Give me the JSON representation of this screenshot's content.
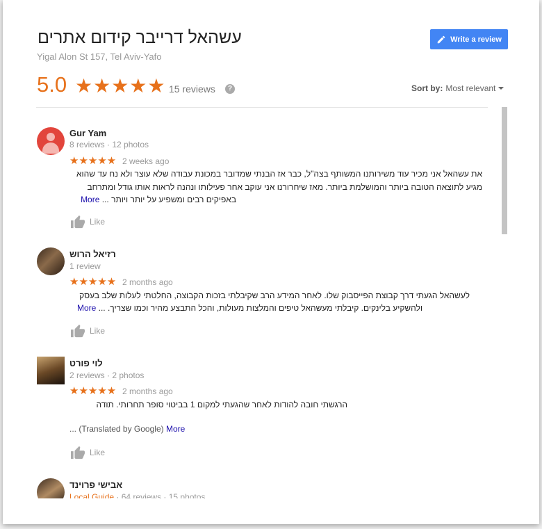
{
  "header": {
    "title": "עשהאל דרייבר קידום אתרים",
    "address": "Yigal Alon St 157, Tel Aviv-Yafo",
    "write_review_label": "Write a review",
    "rating": "5.0",
    "stars": "★★★★★",
    "review_count": "15 reviews",
    "help": "?",
    "sort_label": "Sort by:",
    "sort_value": "Most relevant"
  },
  "colors": {
    "star": "#e7711b",
    "button": "#4285f4",
    "link": "#1a0dab"
  },
  "reviews": [
    {
      "name": "Gur Yam",
      "meta": "8 reviews · 12 photos",
      "stars": "★★★★★",
      "date": "2 weeks ago",
      "text_1": "את עשהאל אני מכיר עוד משירותנו המשותף בצה\"ל, כבר אז הבנתי שמדובר במכונת עבודה שלא עוצר ולא נח עד שהוא",
      "text_2": "מגיע לתוצאה הטובה ביותר והמושלמת ביותר. מאז שיחרורנו אני עוקב אחר פעילותו ונהנה לראות אותו גודל ומתרחב",
      "text_3": "באפיקים רבים ומשפיע על יותר ויותר ...",
      "more": "More",
      "like": "Like"
    },
    {
      "name": "רזיאל הרוש",
      "meta": "1 review",
      "stars": "★★★★★",
      "date": "2 months ago",
      "text_1": "לעשהאל הגעתי דרך קבוצת הפייסבוק שלו. לאחר המידע הרב שקיבלתי בזכות הקבוצה, החלטתי לעלות שלב בעסק",
      "text_2": "ולהשקיע בלינקים. קיבלתי מעשהאל טיפים והמלצות מעולות, והכל התבצע מהיר וכמו שצריך. ...",
      "more": "More",
      "like": "Like"
    },
    {
      "name": "לוי פורט",
      "meta": "2 reviews · 2 photos",
      "stars": "★★★★★",
      "date": "2 months ago",
      "text_1": "הרגשתי חובה להודות לאחר שהגעתי למקום 1 בביטוי סופר תחרותי. תודה",
      "text_2": "... (Translated by Google)",
      "more": "More",
      "like": "Like"
    },
    {
      "name": "אבישי פרוינד",
      "meta_guide": "Local Guide",
      "meta": " · 64 reviews · 15 photos"
    }
  ]
}
